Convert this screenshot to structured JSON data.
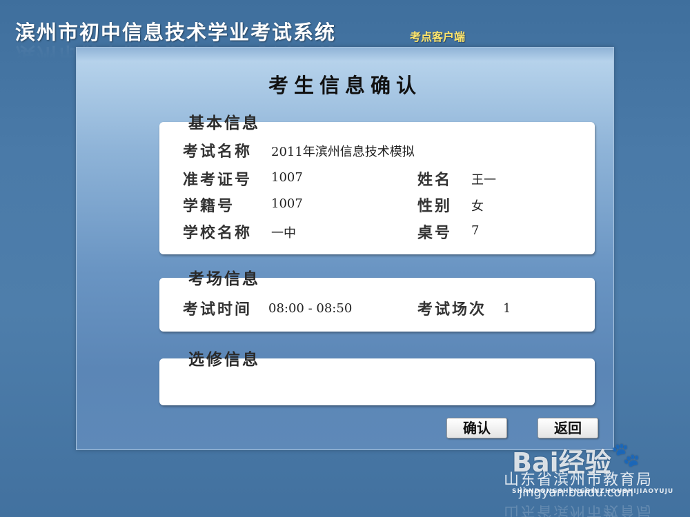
{
  "app": {
    "title": "滨州市初中信息技术学业考试系统",
    "subtitle": "考点客户端"
  },
  "dialog": {
    "title": "考生信息确认"
  },
  "basic_info": {
    "section_label": "基本信息",
    "exam_name_label": "考试名称",
    "exam_name": "2011年滨州信息技术模拟",
    "ticket_no_label": "准考证号",
    "ticket_no": "1007",
    "name_label": "姓名",
    "name": "王一",
    "student_no_label": "学籍号",
    "student_no": "1007",
    "gender_label": "性别",
    "gender": "女",
    "school_label": "学校名称",
    "school": "一中",
    "desk_label": "桌号",
    "desk": "7"
  },
  "exam_room_info": {
    "section_label": "考场信息",
    "time_label": "考试时间",
    "time": "08:00 - 08:50",
    "session_label": "考试场次",
    "session": "1"
  },
  "elective_info": {
    "section_label": "选修信息"
  },
  "buttons": {
    "confirm": "确认",
    "back": "返回"
  },
  "watermark": {
    "logo": "Bai经验",
    "bureau": "山东省滨州市教育局",
    "pinyin": "SHANDONGSHENGBINZHOUSHIJIAOYUJU",
    "url": "jingyan.baidu.com"
  }
}
